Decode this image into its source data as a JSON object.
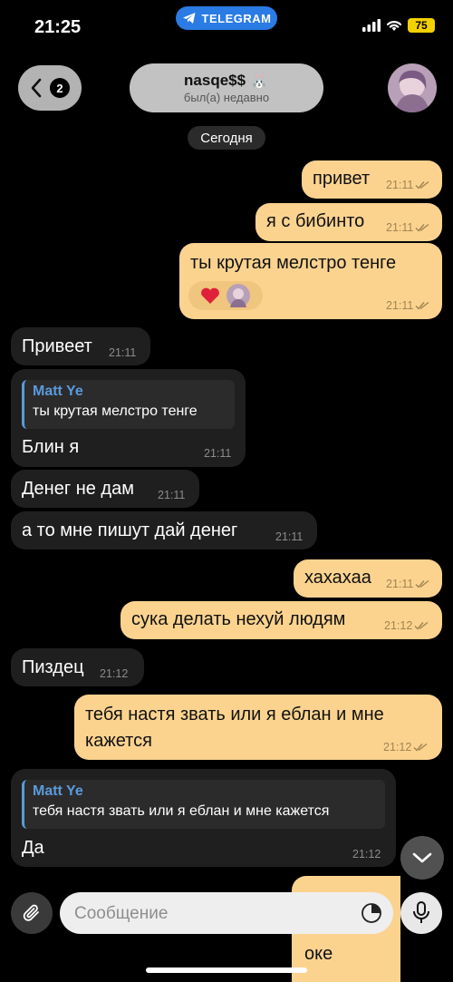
{
  "status_bar": {
    "time": "21:25",
    "app_pill": "TELEGRAM",
    "battery": "75"
  },
  "header": {
    "back_count": "2",
    "chat_name": "nasqe$$ 🐰",
    "chat_status": "был(а) недавно"
  },
  "date_separator": "Сегодня",
  "messages": [
    {
      "text": "привет",
      "time": "21:11"
    },
    {
      "text": "я с бибинто",
      "time": "21:11"
    },
    {
      "text": "ты крутая мелстро тенге",
      "time": "21:11"
    },
    {
      "text": "Привеет",
      "time": "21:11"
    },
    {
      "reply_author": "Matt Ye",
      "reply_text": "ты крутая мелстро тенге",
      "text": "Блин я",
      "time": "21:11"
    },
    {
      "text": "Денег не дам",
      "time": "21:11"
    },
    {
      "text": "а то мне пишут дай денег",
      "time": "21:11"
    },
    {
      "text": "хахахаа",
      "time": "21:11"
    },
    {
      "text": "сука делать нехуй людям",
      "time": "21:12"
    },
    {
      "text": "Пиздец",
      "time": "21:12"
    },
    {
      "text_line1": "тебя настя звать или я еблан и мне",
      "text_line2": "кажется",
      "time": "21:12"
    },
    {
      "reply_author": "Matt Ye",
      "reply_text": "тебя настя звать или я еблан и мне кажется",
      "text": "Да",
      "time": "21:12"
    },
    {
      "text": "оке"
    }
  ],
  "composer": {
    "placeholder": "Сообщение"
  },
  "icons": {
    "telegram": "telegram-icon",
    "signal": "signal-icon",
    "wifi": "wifi-icon",
    "back": "chevron-left-icon",
    "scroll_down": "chevron-down-icon",
    "attach": "paperclip-icon",
    "sticker": "sticker-icon",
    "mic": "microphone-icon",
    "read": "double-check-icon",
    "heart": "heart-icon"
  },
  "colors": {
    "outgoing_bubble": "#fbd38f",
    "incoming_bubble": "#1f1f1f",
    "reply_accent": "#5a9bdc",
    "telegram_pill": "#2a7be4",
    "battery": "#f5d000"
  }
}
